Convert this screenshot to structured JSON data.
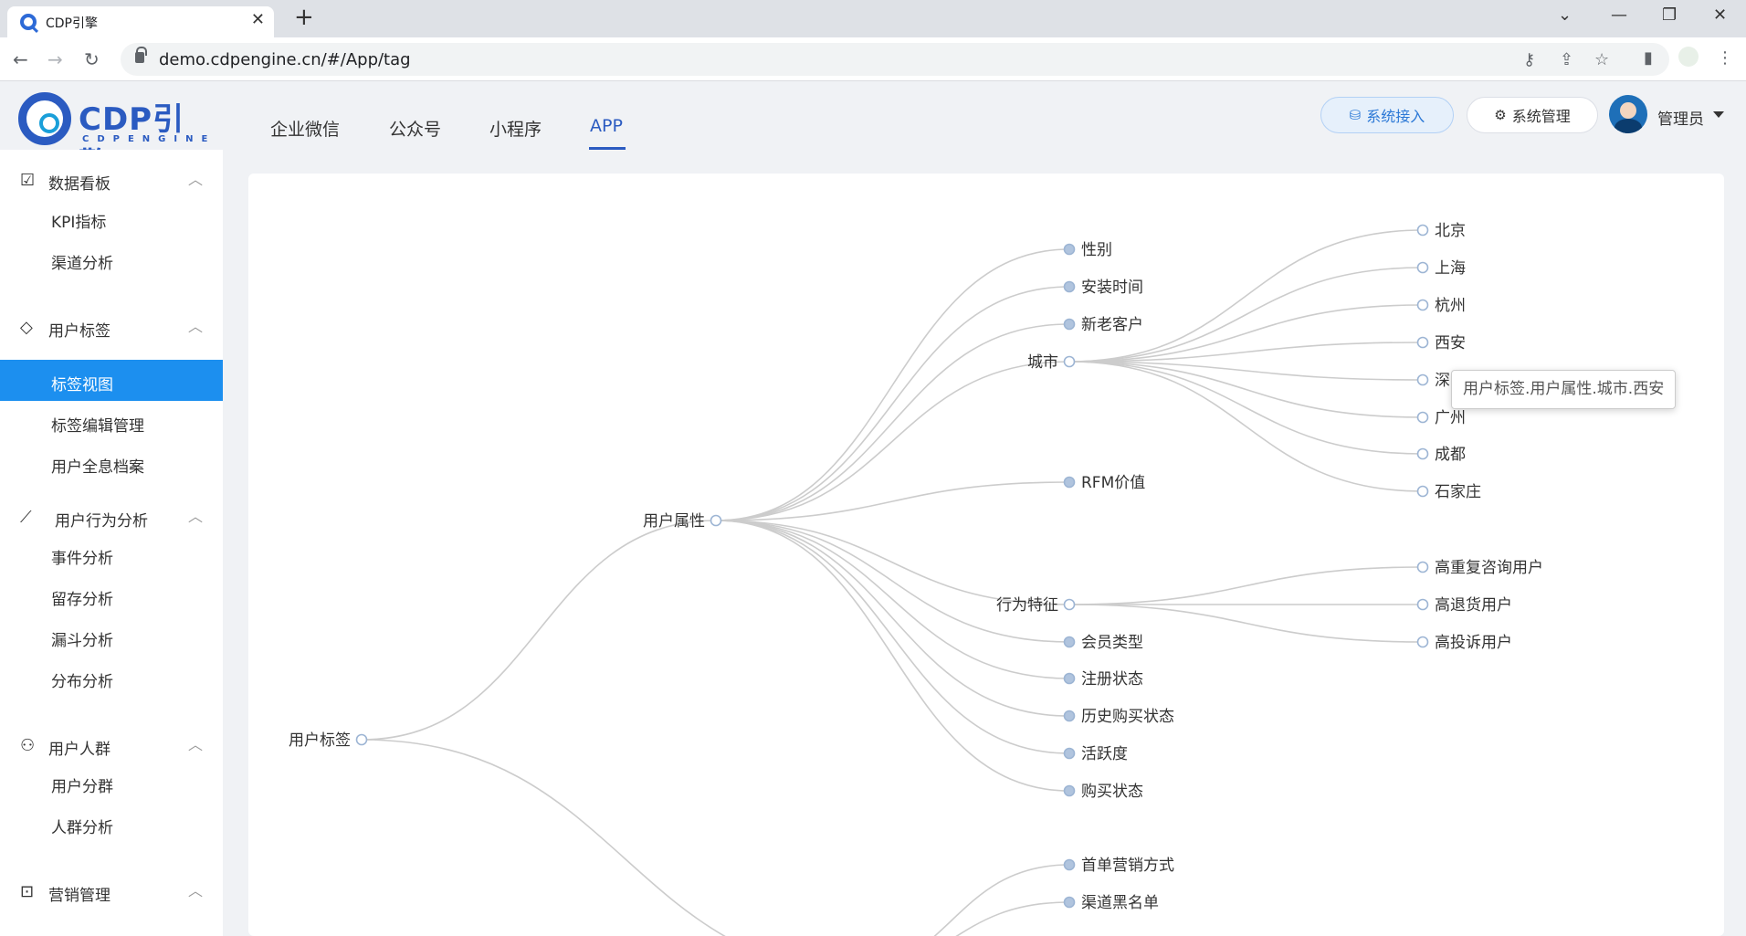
{
  "browser": {
    "tab_title": "CDP引擎",
    "url": "demo.cdpengine.cn/#/App/tag"
  },
  "logo": {
    "name": "CDP引擎",
    "sub": "CDPENGINE"
  },
  "topnav": [
    {
      "label": "企业微信",
      "active": false
    },
    {
      "label": "公众号",
      "active": false
    },
    {
      "label": "小程序",
      "active": false
    },
    {
      "label": "APP",
      "active": true
    }
  ],
  "header": {
    "access_label": "系统接入",
    "manage_label": "系统管理",
    "username": "管理员"
  },
  "sidebar": {
    "groups": [
      {
        "label": "数据看板",
        "icon": "chart-icon",
        "items": [
          "KPI指标",
          "渠道分析"
        ]
      },
      {
        "label": "用户标签",
        "icon": "tag-icon",
        "items": [
          "标签视图",
          "标签编辑管理",
          "用户全息档案"
        ]
      },
      {
        "label": "用户行为分析",
        "icon": "trend-icon",
        "items": [
          "事件分析",
          "留存分析",
          "漏斗分析",
          "分布分析"
        ]
      },
      {
        "label": "用户人群",
        "icon": "people-icon",
        "items": [
          "用户分群",
          "人群分析"
        ]
      },
      {
        "label": "营销管理",
        "icon": "marketing-icon",
        "items": []
      }
    ],
    "active_item": "标签视图"
  },
  "tree": {
    "root": "用户标签",
    "level1": "用户属性",
    "attributes": [
      "性别",
      "安装时间",
      "新老客户",
      "城市",
      "RFM价值",
      "行为特征",
      "会员类型",
      "注册状态",
      "历史购买状态",
      "活跃度",
      "购买状态"
    ],
    "cities": [
      "北京",
      "上海",
      "杭州",
      "西安",
      "深",
      "广州",
      "成都",
      "石家庄"
    ],
    "behaviors": [
      "高重复咨询用户",
      "高退货用户",
      "高投诉用户"
    ],
    "marketing_children": [
      "首单营销方式",
      "渠道黑名单"
    ]
  },
  "tooltip": "用户标签.用户属性.城市.西安"
}
